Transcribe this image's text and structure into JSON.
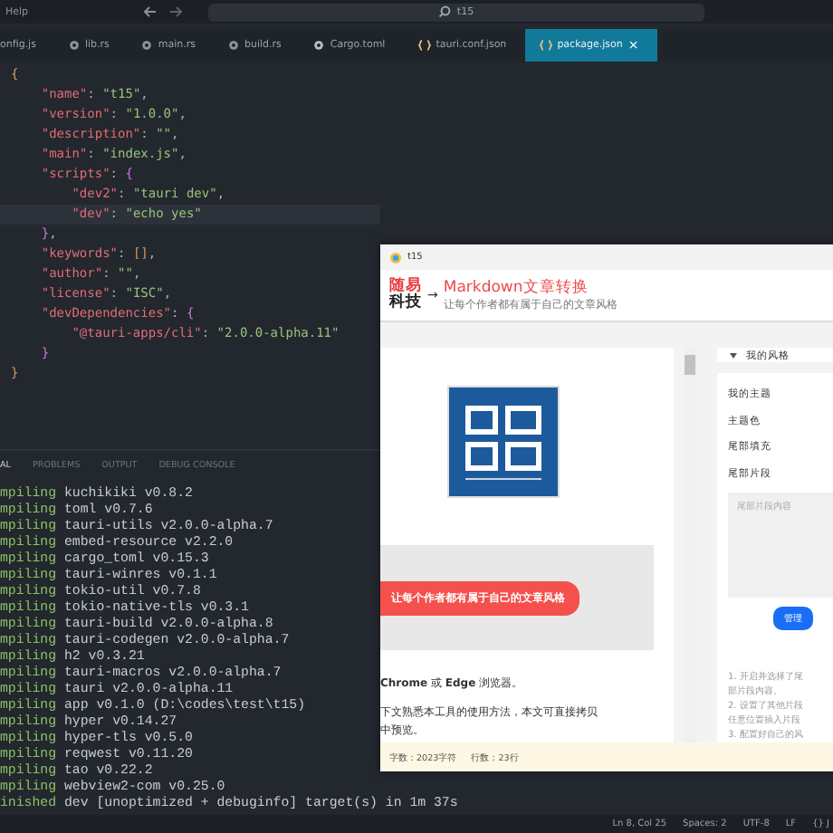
{
  "menu": {
    "label": "Help"
  },
  "search": {
    "value": "t15"
  },
  "tabs": [
    {
      "label": "onfig.js",
      "kind": "plain",
      "selected": false
    },
    {
      "label": "lib.rs",
      "kind": "rust",
      "selected": false
    },
    {
      "label": "main.rs",
      "kind": "rust",
      "selected": false
    },
    {
      "label": "build.rs",
      "kind": "rust",
      "selected": false
    },
    {
      "label": "Cargo.toml",
      "kind": "config",
      "selected": false
    },
    {
      "label": "tauri.conf.json",
      "kind": "json",
      "selected": false
    },
    {
      "label": "package.json",
      "kind": "json",
      "selected": true,
      "close": "×"
    }
  ],
  "code_lines": [
    {
      "segments": [
        {
          "text": "{",
          "kind": "brace"
        }
      ]
    },
    {
      "segments": [
        {
          "text": "    \"name\"",
          "kind": "key"
        },
        {
          "text": ": ",
          "kind": "punct"
        },
        {
          "text": "\"t15\"",
          "kind": "str"
        },
        {
          "text": ",",
          "kind": "punct"
        }
      ]
    },
    {
      "segments": [
        {
          "text": "    \"version\"",
          "kind": "key"
        },
        {
          "text": ": ",
          "kind": "punct"
        },
        {
          "text": "\"1.0.0\"",
          "kind": "str"
        },
        {
          "text": ",",
          "kind": "punct"
        }
      ]
    },
    {
      "segments": [
        {
          "text": "    \"description\"",
          "kind": "key"
        },
        {
          "text": ": ",
          "kind": "punct"
        },
        {
          "text": "\"\"",
          "kind": "str"
        },
        {
          "text": ",",
          "kind": "punct"
        }
      ]
    },
    {
      "segments": [
        {
          "text": "    \"main\"",
          "kind": "key"
        },
        {
          "text": ": ",
          "kind": "punct"
        },
        {
          "text": "\"index.js\"",
          "kind": "str"
        },
        {
          "text": ",",
          "kind": "punct"
        }
      ]
    },
    {
      "segments": [
        {
          "text": "    \"scripts\"",
          "kind": "key"
        },
        {
          "text": ": ",
          "kind": "punct"
        },
        {
          "text": "{",
          "kind": "brace2"
        }
      ]
    },
    {
      "segments": [
        {
          "text": "        \"dev2\"",
          "kind": "key"
        },
        {
          "text": ": ",
          "kind": "punct"
        },
        {
          "text": "\"tauri dev\"",
          "kind": "str"
        },
        {
          "text": ",",
          "kind": "punct"
        }
      ]
    },
    {
      "segments": [
        {
          "text": "        \"dev\"",
          "kind": "key"
        },
        {
          "text": ": ",
          "kind": "punct"
        },
        {
          "text": "\"echo yes\"",
          "kind": "str"
        }
      ],
      "current": true
    },
    {
      "segments": [
        {
          "text": "    }",
          "kind": "brace2"
        },
        {
          "text": ",",
          "kind": "punct"
        }
      ]
    },
    {
      "segments": [
        {
          "text": "    \"keywords\"",
          "kind": "key"
        },
        {
          "text": ": ",
          "kind": "punct"
        },
        {
          "text": "[]",
          "kind": "brace"
        },
        {
          "text": ",",
          "kind": "punct"
        }
      ]
    },
    {
      "segments": [
        {
          "text": "    \"author\"",
          "kind": "key"
        },
        {
          "text": ": ",
          "kind": "punct"
        },
        {
          "text": "\"\"",
          "kind": "str"
        },
        {
          "text": ",",
          "kind": "punct"
        }
      ]
    },
    {
      "segments": [
        {
          "text": "    \"license\"",
          "kind": "key"
        },
        {
          "text": ": ",
          "kind": "punct"
        },
        {
          "text": "\"ISC\"",
          "kind": "str"
        },
        {
          "text": ",",
          "kind": "punct"
        }
      ]
    },
    {
      "segments": [
        {
          "text": "    \"devDependencies\"",
          "kind": "key"
        },
        {
          "text": ": ",
          "kind": "punct"
        },
        {
          "text": "{",
          "kind": "brace2"
        }
      ]
    },
    {
      "segments": [
        {
          "text": "        \"@tauri-apps/cli\"",
          "kind": "key"
        },
        {
          "text": ": ",
          "kind": "punct"
        },
        {
          "text": "\"2.0.0-alpha.11\"",
          "kind": "str"
        }
      ]
    },
    {
      "segments": [
        {
          "text": "    }",
          "kind": "brace2"
        }
      ]
    },
    {
      "segments": [
        {
          "text": "}",
          "kind": "brace"
        }
      ]
    }
  ],
  "panel_tabs": [
    {
      "label": "AL",
      "selected": true
    },
    {
      "label": "PROBLEMS",
      "selected": false
    },
    {
      "label": "OUTPUT",
      "selected": false
    },
    {
      "label": "DEBUG CONSOLE",
      "selected": false
    }
  ],
  "terminal_lines": [
    {
      "verb": "mpiling",
      "rest": " kuchikiki v0.8.2"
    },
    {
      "verb": "mpiling",
      "rest": " toml v0.7.6"
    },
    {
      "verb": "mpiling",
      "rest": " tauri-utils v2.0.0-alpha.7"
    },
    {
      "verb": "mpiling",
      "rest": " embed-resource v2.2.0"
    },
    {
      "verb": "mpiling",
      "rest": " cargo_toml v0.15.3"
    },
    {
      "verb": "mpiling",
      "rest": " tauri-winres v0.1.1"
    },
    {
      "verb": "mpiling",
      "rest": " tokio-util v0.7.8"
    },
    {
      "verb": "mpiling",
      "rest": " tokio-native-tls v0.3.1"
    },
    {
      "verb": "mpiling",
      "rest": " tauri-build v2.0.0-alpha.8"
    },
    {
      "verb": "mpiling",
      "rest": " tauri-codegen v2.0.0-alpha.7"
    },
    {
      "verb": "mpiling",
      "rest": " h2 v0.3.21"
    },
    {
      "verb": "mpiling",
      "rest": " tauri-macros v2.0.0-alpha.7"
    },
    {
      "verb": "mpiling",
      "rest": " tauri v2.0.0-alpha.11"
    },
    {
      "verb": "mpiling",
      "rest": " app v0.1.0 (D:\\codes\\test\\t15)"
    },
    {
      "verb": "mpiling",
      "rest": " hyper v0.14.27"
    },
    {
      "verb": "mpiling",
      "rest": " hyper-tls v0.5.0"
    },
    {
      "verb": "mpiling",
      "rest": " reqwest v0.11.20"
    },
    {
      "verb": "mpiling",
      "rest": " tao v0.22.2"
    },
    {
      "verb": "mpiling",
      "rest": " webview2-com v0.25.0"
    },
    {
      "verb": "inished",
      "rest": " dev [unoptimized + debuginfo] target(s) in 1m 37s"
    }
  ],
  "status_bar": [
    "Ln 8, Col 25",
    "Spaces: 2",
    "UTF-8",
    "LF",
    "{} J"
  ],
  "app_window": {
    "title": "t15",
    "header": {
      "logo_top": "随易",
      "logo_bottom": "科技",
      "arrow": "→",
      "title": "Markdown文章转换",
      "subtitle": "让每个作者都有属于自己的文章风格"
    },
    "preview": {
      "image": {
        "kind": "picture"
      },
      "banner": "让每个作者都有属于自己的文章风格",
      "paragraphs": [
        "**Chrome** 或 **Edge** 浏览器。",
        "下文熟悉本工具的使用方法，本文可直接拷贝",
        "中预览。"
      ]
    },
    "settings": {
      "section": "我的风格",
      "expanded": true,
      "fields": [
        "我的主题",
        "主题色",
        "尾部填充",
        "尾部片段"
      ],
      "placeholder": "尾部片段内容",
      "button": "管理",
      "notes": [
        "1. 开启并选择了尾",
        "部片段内容。",
        "2. 设置了其他片段",
        "任意位置插入片段",
        "3. 配置好自己的风"
      ]
    },
    "footer": {
      "chars": "字数：2023字符",
      "lines": "行数：23行"
    }
  }
}
